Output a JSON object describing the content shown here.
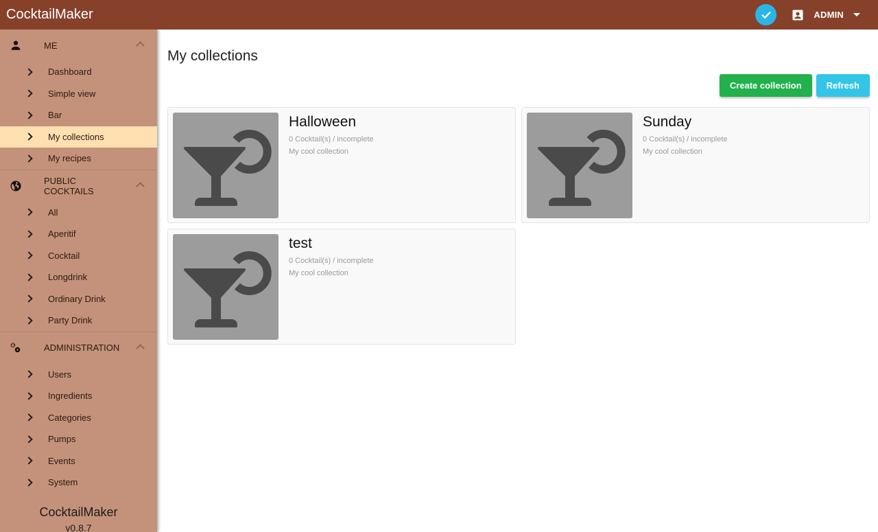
{
  "app": {
    "title": "CocktailMaker",
    "version": "v0.8.7"
  },
  "topbar": {
    "user_name": "ADMIN",
    "status_icon": "check-circle-icon",
    "user_icon": "account-box-icon"
  },
  "sidebar": {
    "sections": [
      {
        "label": "ME",
        "icon": "person-icon",
        "items": [
          {
            "label": "Dashboard"
          },
          {
            "label": "Simple view"
          },
          {
            "label": "Bar"
          },
          {
            "label": "My collections",
            "active": true
          },
          {
            "label": "My recipes"
          }
        ]
      },
      {
        "label": "PUBLIC COCKTAILS",
        "icon": "globe-icon",
        "items": [
          {
            "label": "All"
          },
          {
            "label": "Aperitif"
          },
          {
            "label": "Cocktail"
          },
          {
            "label": "Longdrink"
          },
          {
            "label": "Ordinary Drink"
          },
          {
            "label": "Party Drink"
          }
        ]
      },
      {
        "label": "ADMINISTRATION",
        "icon": "gears-icon",
        "items": [
          {
            "label": "Users"
          },
          {
            "label": "Ingredients"
          },
          {
            "label": "Categories"
          },
          {
            "label": "Pumps"
          },
          {
            "label": "Events"
          },
          {
            "label": "System"
          }
        ]
      }
    ]
  },
  "main": {
    "title": "My collections",
    "buttons": {
      "create": "Create collection",
      "refresh": "Refresh"
    },
    "colors": {
      "create": "#22b14c",
      "refresh": "#33c5e8",
      "header": "#87412a",
      "sidebar": "#c4927a",
      "active": "#ffe0b0"
    },
    "collections": [
      {
        "name": "Halloween",
        "meta": "0 Cocktail(s) / incomplete",
        "description": "My cool collection"
      },
      {
        "name": "Sunday",
        "meta": "0 Cocktail(s) / incomplete",
        "description": "My cool collection"
      },
      {
        "name": "test",
        "meta": "0 Cocktail(s) / incomplete",
        "description": "My cool collection"
      }
    ]
  }
}
